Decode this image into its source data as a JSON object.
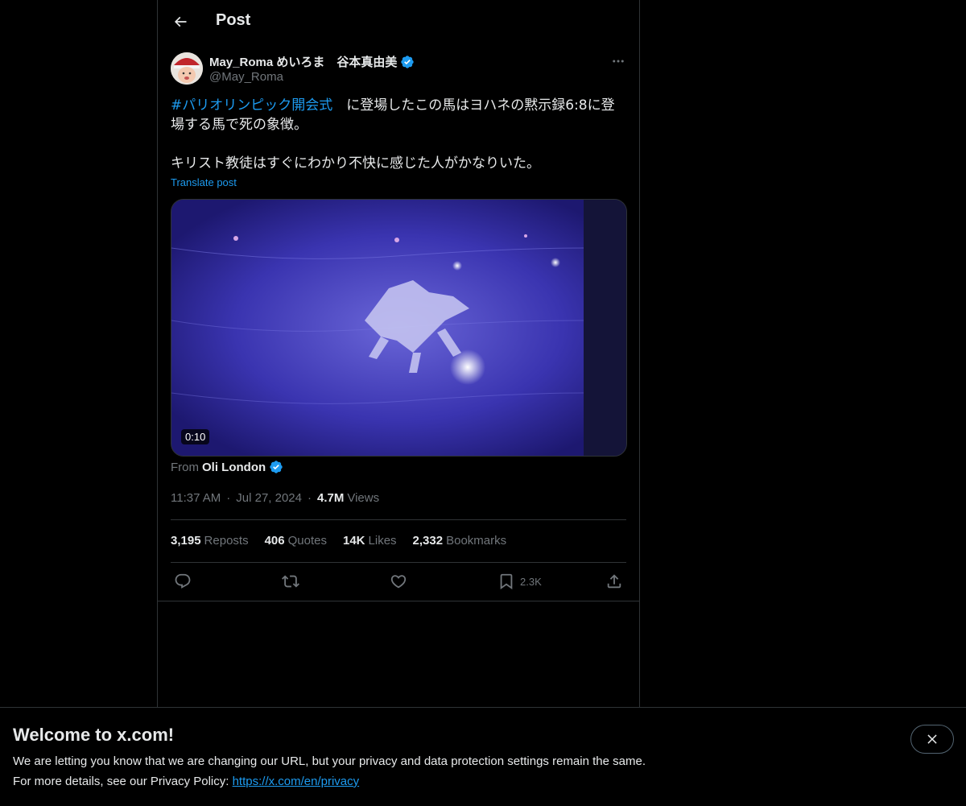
{
  "header": {
    "title": "Post"
  },
  "author": {
    "display_name": "May_Roma めいろま　谷本真由美",
    "handle": "@May_Roma"
  },
  "post": {
    "hashtag": "#パリオリンピック開会式",
    "text_after_hashtag": "　に登場したこの馬はヨハネの黙示録6:8に登場する馬で死の象徴。\n\nキリスト教徒はすぐにわかり不快に感じた人がかなりいた。",
    "translate_label": "Translate post",
    "video_duration": "0:10",
    "from_label": "From",
    "from_name": "Oli London",
    "time": "11:37 AM",
    "date": "Jul 27, 2024",
    "views_count": "4.7M",
    "views_label": "Views"
  },
  "stats": {
    "reposts_count": "3,195",
    "reposts_label": "Reposts",
    "quotes_count": "406",
    "quotes_label": "Quotes",
    "likes_count": "14K",
    "likes_label": "Likes",
    "bookmarks_count": "2,332",
    "bookmarks_label": "Bookmarks"
  },
  "actions": {
    "bookmark_count": "2.3K"
  },
  "banner": {
    "title": "Welcome to x.com!",
    "line1": "We are letting you know that we are changing our URL, but your privacy and data protection settings remain the same.",
    "line2_prefix": "For more details, see our Privacy Policy: ",
    "link": "https://x.com/en/privacy"
  },
  "colors": {
    "accent": "#1d9bf0",
    "background": "#000000",
    "text_primary": "#e7e9ea",
    "text_secondary": "#71767b",
    "border": "#2f3336"
  },
  "icons": {
    "back": "arrow-left-icon",
    "verified": "verified-badge-icon",
    "more": "more-dots-icon",
    "reply": "reply-icon",
    "repost": "repost-icon",
    "like": "heart-icon",
    "bookmark": "bookmark-icon",
    "share": "share-icon",
    "close": "close-icon"
  }
}
